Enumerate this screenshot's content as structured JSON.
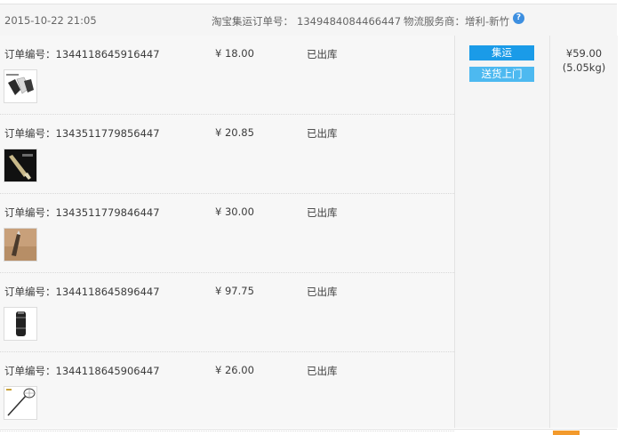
{
  "header": {
    "datetime": "2015-10-22 21:05",
    "taobao_label": "淘宝集运订单号：",
    "taobao_number": "1349484084466447",
    "logistics_label": "物流服务商：",
    "logistics_value": "增利-新竹",
    "help_icon_glyph": "?"
  },
  "order_prefix": "订单编号：",
  "orders": [
    {
      "number": "1344118645916447",
      "price": "¥ 18.00",
      "status": "已出库",
      "thumb_icon": "gloves-product-thumbnail"
    },
    {
      "number": "1343511779856447",
      "price": "¥ 20.85",
      "status": "已出库",
      "thumb_icon": "tool-product-thumbnail"
    },
    {
      "number": "1343511779846447",
      "price": "¥ 30.00",
      "status": "已出库",
      "thumb_icon": "knife-product-thumbnail"
    },
    {
      "number": "1344118645896447",
      "price": "¥ 97.75",
      "status": "已出库",
      "thumb_icon": "flashlight-product-thumbnail"
    },
    {
      "number": "1344118645906447",
      "price": "¥ 26.00",
      "status": "已出库",
      "thumb_icon": "net-product-thumbnail"
    }
  ],
  "actions": {
    "consolidate_label": "集运",
    "deliver_label": "送货上门"
  },
  "summary": {
    "total": "¥59.00",
    "weight": "(5.05kg)"
  },
  "colors": {
    "consolidate_button": "#1a9be8",
    "deliver_button": "#4db9f0",
    "help_icon": "#3d8fe0",
    "accent_bottom": "#f39a2c"
  }
}
